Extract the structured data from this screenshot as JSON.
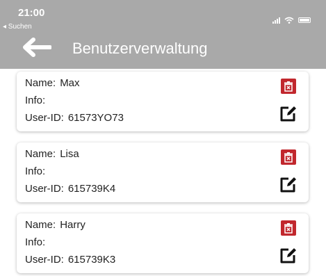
{
  "status_bar": {
    "time": "21:00",
    "back_app": "◂ Suchen"
  },
  "header": {
    "title": "Benutzerverwaltung"
  },
  "labels": {
    "name": "Name:",
    "info": "Info:",
    "user_id": "User-ID:"
  },
  "users": [
    {
      "name": "Max",
      "info": "",
      "user_id": "61573YO73"
    },
    {
      "name": "Lisa",
      "info": "",
      "user_id": "615739K4"
    },
    {
      "name": "Harry",
      "info": "",
      "user_id": "615739K3"
    }
  ],
  "icons": {
    "back": "arrow-left-icon",
    "delete": "trash-icon",
    "edit": "edit-icon"
  },
  "colors": {
    "header_bg": "#a9a9a9",
    "delete_bg": "#c1272d"
  }
}
